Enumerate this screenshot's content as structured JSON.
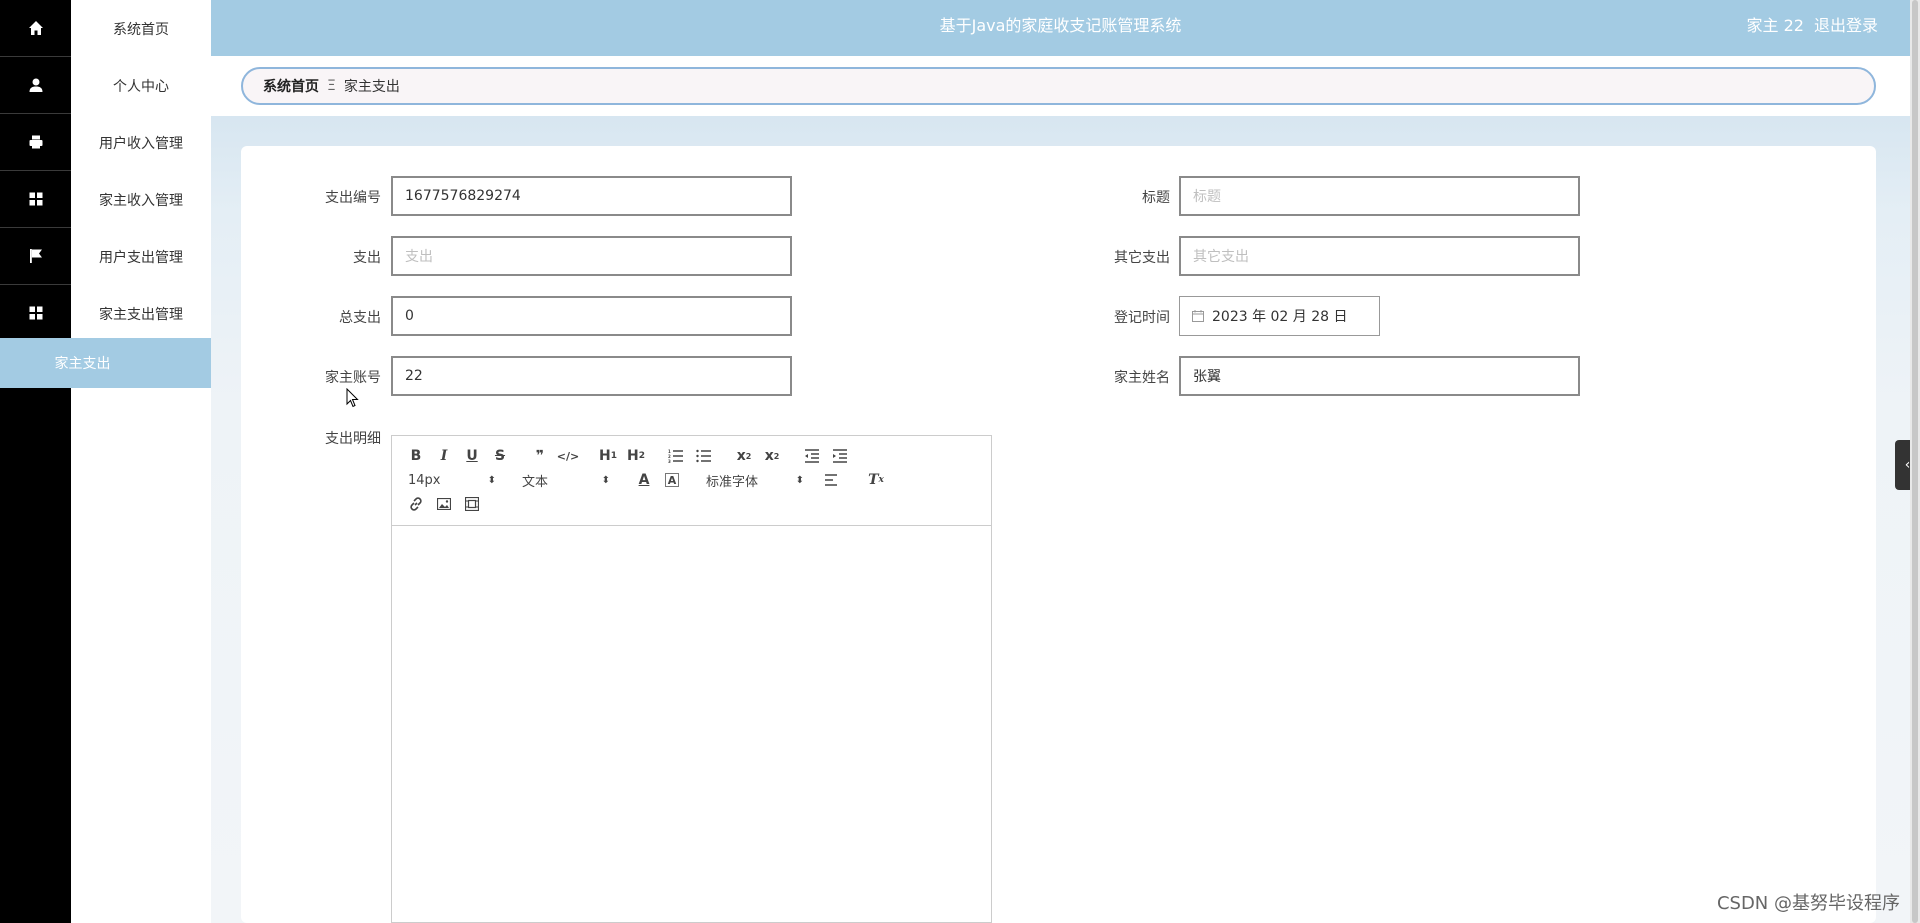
{
  "header": {
    "title": "基于Java的家庭收支记账管理系统",
    "user_label": "家主 22",
    "logout_label": "退出登录"
  },
  "sidebar": {
    "items": [
      {
        "label": "系统首页",
        "icon": "home-icon"
      },
      {
        "label": "个人中心",
        "icon": "user-icon"
      },
      {
        "label": "用户收入管理",
        "icon": "printer-icon"
      },
      {
        "label": "家主收入管理",
        "icon": "grid-icon"
      },
      {
        "label": "用户支出管理",
        "icon": "flag-icon"
      },
      {
        "label": "家主支出管理",
        "icon": "grid-icon"
      }
    ],
    "active_sub": "家主支出"
  },
  "breadcrumb": {
    "home": "系统首页",
    "separator": "Ξ",
    "current": "家主支出"
  },
  "form": {
    "expense_no": {
      "label": "支出编号",
      "value": "1677576829274"
    },
    "title": {
      "label": "标题",
      "placeholder": "标题"
    },
    "expense": {
      "label": "支出",
      "placeholder": "支出"
    },
    "other_expense": {
      "label": "其它支出",
      "placeholder": "其它支出"
    },
    "total_expense": {
      "label": "总支出",
      "value": "0"
    },
    "record_time": {
      "label": "登记时间",
      "value": "2023 年 02 月 28 日"
    },
    "owner_account": {
      "label": "家主账号",
      "value": "22"
    },
    "owner_name": {
      "label": "家主姓名",
      "value": "张翼"
    },
    "detail": {
      "label": "支出明细"
    }
  },
  "editor": {
    "font_size": "14px",
    "text_type": "文本",
    "font_family": "标准字体"
  },
  "watermark": "CSDN @基努毕设程序"
}
